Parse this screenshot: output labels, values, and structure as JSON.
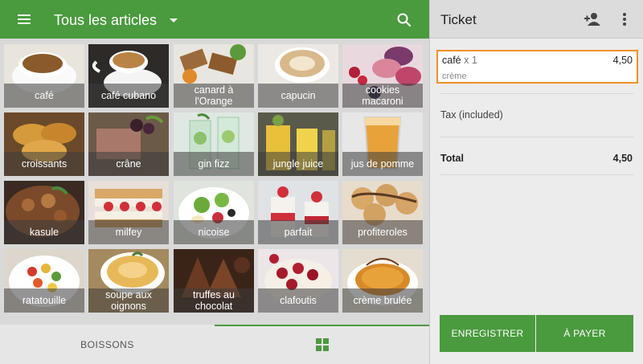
{
  "header": {
    "title": "Tous les articles"
  },
  "tiles": [
    {
      "name": "café"
    },
    {
      "name": "café cubano"
    },
    {
      "name": "canard à l'Orange"
    },
    {
      "name": "capucin"
    },
    {
      "name": "cookies macaroni"
    },
    {
      "name": "croissants"
    },
    {
      "name": "crâne"
    },
    {
      "name": "gin fizz"
    },
    {
      "name": "jungle juice"
    },
    {
      "name": "jus de pomme"
    },
    {
      "name": "kasule"
    },
    {
      "name": "milfey"
    },
    {
      "name": "nicoise"
    },
    {
      "name": "parfait"
    },
    {
      "name": "profiteroles"
    },
    {
      "name": "ratatouille"
    },
    {
      "name": "soupe aux oignons"
    },
    {
      "name": "truffes au chocolat"
    },
    {
      "name": "clafoutis"
    },
    {
      "name": "crème brulée"
    }
  ],
  "bottom_tabs": {
    "boissons": "BOISSONS"
  },
  "ticket": {
    "title": "Ticket",
    "line_item": {
      "name": "café",
      "qty": "x 1",
      "price": "4,50",
      "modifier": "crème"
    },
    "tax_label": "Tax (included)",
    "total_label": "Total",
    "total_value": "4,50",
    "save_label": "ENREGISTRER",
    "pay_label": "À PAYER"
  },
  "colors": {
    "primary": "#4a9a3e",
    "highlight": "#f0902a"
  }
}
